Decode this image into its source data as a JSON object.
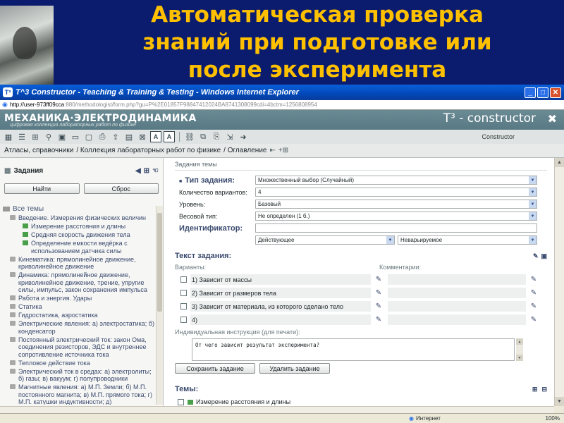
{
  "slide": {
    "title_lines": [
      "Автоматическая проверка",
      "знаний при подготовке или",
      "после эксперимента"
    ]
  },
  "browser": {
    "window_title": "T^3 Constructor - Teaching & Training & Testing - Windows Internet Explorer",
    "url_main": "http://user-973ff09cca",
    "url_rest": ":880/methodologist/form.php?gu=P%2E01857F98847412024BA8741308099cdi=4bctm=1256808954",
    "status_zone": "Интернет",
    "status_zoom": "100%"
  },
  "app": {
    "brand_title": "МЕХАНИКА·ЭЛЕКТРОДИНАМИКА",
    "brand_subtitle": "цифровая коллекция лабораторных работ по физике",
    "product_name": "T³ - constructor",
    "constructor_label": "Constructor"
  },
  "breadcrumb": {
    "items": [
      "Атласы, справочники",
      "/ Коллекция лабораторных работ по физике",
      "/ Оглавление"
    ]
  },
  "tasks_panel": {
    "title": "Задания",
    "find_button": "Найти",
    "reset_button": "Сброс",
    "tree": [
      {
        "label": "Все темы",
        "level": 0,
        "kind": "root"
      },
      {
        "label": "Введение. Измерения физических величин",
        "level": 1,
        "kind": "folder"
      },
      {
        "label": "Измерение расстояния и длины",
        "level": 2,
        "kind": "leaf"
      },
      {
        "label": "Средняя скорость движения тела",
        "level": 2,
        "kind": "leaf"
      },
      {
        "label": "Определение емкости ведёрка с использованием датчика силы",
        "level": 2,
        "kind": "leaf"
      },
      {
        "label": "Кинематика: прямолинейное движение, криволинейное движение",
        "level": 1,
        "kind": "folder"
      },
      {
        "label": "Динамика: прямолинейное движение, криволинейное движение, трение, упругие силы, импульс, закон сохранения импульса",
        "level": 1,
        "kind": "folder"
      },
      {
        "label": "Работа и энергия. Удары",
        "level": 1,
        "kind": "folder"
      },
      {
        "label": "Статика",
        "level": 1,
        "kind": "folder"
      },
      {
        "label": "Гидростатика, аэростатика",
        "level": 1,
        "kind": "folder"
      },
      {
        "label": "Электрические явления: а) электростатика; б) конденсатор",
        "level": 1,
        "kind": "folder"
      },
      {
        "label": "Постоянный электрический ток: закон Ома, соединения резисторов, ЭДС и внутреннее сопротивление источника тока",
        "level": 1,
        "kind": "folder"
      },
      {
        "label": "Тепловое действие тока",
        "level": 1,
        "kind": "folder"
      },
      {
        "label": "Электрический ток в средах: а) электролиты; б) газы; в) вакуум; г) полупроводники",
        "level": 1,
        "kind": "folder"
      },
      {
        "label": "Магнитные явления: а) М.П. Земли; б) М.П. постоянного магнита; в) М.П. прямого тока; г) М.П. катушки индуктивности; д)",
        "level": 1,
        "kind": "folder"
      }
    ]
  },
  "task_form": {
    "panel_title": "Задания темы",
    "type_label": "Тип задания:",
    "type_value": "Множественный выбор (Случайный)",
    "variants_count_label": "Количество вариантов:",
    "variants_count_value": "4",
    "level_label": "Уровень:",
    "level_value": "Базовый",
    "weight_label": "Весовой тип:",
    "weight_value": "Не определен (1 б.)",
    "identifier_label": "Идентификатор:",
    "status_value": "Действующее",
    "variability_value": "Неварьируемое",
    "text_section": "Текст задания:",
    "variants_label": "Варианты:",
    "comments_label": "Комментарии:",
    "variants": [
      "1) Зависит от массы",
      "2) Зависит от размеров тела",
      "3) Зависит от материала, из которого сделано тело",
      "4)"
    ],
    "instruction_label": "Индивидуальная инструкция (для печати):",
    "instruction_text": "От чего зависит результат эксперимента?",
    "save_button": "Сохранить задание",
    "delete_button": "Удалить задание",
    "topics_title": "Темы:",
    "topic_item": "Измерение расстояния и длины"
  }
}
